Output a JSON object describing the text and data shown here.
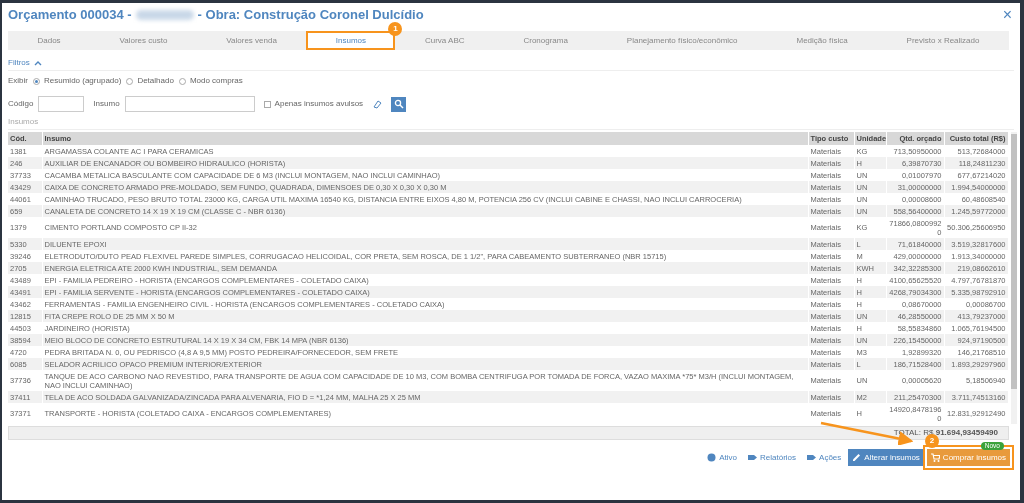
{
  "window": {
    "title_prefix": "Orçamento 000034 -",
    "title_suffix": "- Obra: Construção Coronel Dulcídio",
    "close": "×"
  },
  "tabs": [
    {
      "label": "Dados",
      "selected": false
    },
    {
      "label": "Valores custo",
      "selected": false
    },
    {
      "label": "Valores venda",
      "selected": false
    },
    {
      "label": "Insumos",
      "selected": true,
      "callout": "1"
    },
    {
      "label": "Curva ABC",
      "selected": false
    },
    {
      "label": "Cronograma",
      "selected": false
    },
    {
      "label": "Planejamento físico/econômico",
      "selected": false
    },
    {
      "label": "Medição física",
      "selected": false
    },
    {
      "label": "Previsto x Realizado",
      "selected": false
    }
  ],
  "filters": {
    "title": "Filtros",
    "expanded": true,
    "show_label": "Exibir",
    "radios": [
      {
        "label": "Resumido (agrupado)",
        "selected": true
      },
      {
        "label": "Detalhado",
        "selected": false
      },
      {
        "label": "Modo compras",
        "selected": false
      }
    ],
    "code_label": "Código",
    "item_label": "Insumo",
    "only_loose": {
      "label": "Apenas insumos avulsos",
      "checked": false
    }
  },
  "table": {
    "section": "Insumos",
    "columns": [
      "Cód.",
      "Insumo",
      "Tipo custo",
      "Unidade",
      "Qtd. orçado",
      "Custo total (R$)"
    ],
    "rows": [
      [
        "1381",
        "ARGAMASSA COLANTE AC I PARA CERAMICAS",
        "Materiais",
        "KG",
        "713,50950000",
        "513,72684000"
      ],
      [
        "246",
        "AUXILIAR DE ENCANADOR OU BOMBEIRO HIDRAULICO (HORISTA)",
        "Materiais",
        "H",
        "6,39870730",
        "118,24811230"
      ],
      [
        "37733",
        "CACAMBA METALICA BASCULANTE COM CAPACIDADE DE 6 M3 (INCLUI MONTAGEM, NAO INCLUI CAMINHAO)",
        "Materiais",
        "UN",
        "0,01007970",
        "677,67214020"
      ],
      [
        "43429",
        "CAIXA DE CONCRETO ARMADO PRE-MOLDADO, SEM FUNDO, QUADRADA, DIMENSOES DE 0,30 X 0,30 X 0,30 M",
        "Materiais",
        "UN",
        "31,00000000",
        "1.994,54000000"
      ],
      [
        "44061",
        "CAMINHAO TRUCADO, PESO BRUTO TOTAL 23000 KG, CARGA UTIL MAXIMA 16540 KG, DISTANCIA ENTRE EIXOS 4,80 M, POTENCIA 256 CV (INCLUI CABINE E CHASSI, NAO INCLUI CARROCERIA)",
        "Materiais",
        "UN",
        "0,00008600",
        "60,48608540"
      ],
      [
        "659",
        "CANALETA DE CONCRETO 14 X 19 X 19 CM (CLASSE C - NBR 6136)",
        "Materiais",
        "UN",
        "558,56400000",
        "1.245,59772000"
      ],
      [
        "1379",
        "CIMENTO PORTLAND COMPOSTO CP II-32",
        "Materiais",
        "KG",
        "71866,08009920",
        "50.306,25606950"
      ],
      [
        "5330",
        "DILUENTE EPOXI",
        "Materiais",
        "L",
        "71,61840000",
        "3.519,32817600"
      ],
      [
        "39246",
        "ELETRODUTO/DUTO PEAD FLEXIVEL PAREDE SIMPLES, CORRUGACAO HELICOIDAL, COR PRETA, SEM ROSCA, DE 1 1/2\", PARA CABEAMENTO SUBTERRANEO (NBR 15715)",
        "Materiais",
        "M",
        "429,00000000",
        "1.913,34000000"
      ],
      [
        "2705",
        "ENERGIA ELETRICA ATE 2000 KWH INDUSTRIAL, SEM DEMANDA",
        "Materiais",
        "KWH",
        "342,32285300",
        "219,08662610"
      ],
      [
        "43489",
        "EPI - FAMILIA PEDREIRO - HORISTA (ENCARGOS COMPLEMENTARES - COLETADO CAIXA)",
        "Materiais",
        "H",
        "4100,65625520",
        "4.797,76781870"
      ],
      [
        "43491",
        "EPI - FAMILIA SERVENTE - HORISTA (ENCARGOS COMPLEMENTARES - COLETADO CAIXA)",
        "Materiais",
        "H",
        "4268,79034300",
        "5.335,98792910"
      ],
      [
        "43462",
        "FERRAMENTAS - FAMILIA ENGENHEIRO CIVIL - HORISTA (ENCARGOS COMPLEMENTARES - COLETADO CAIXA)",
        "Materiais",
        "H",
        "0,08670000",
        "0,00086700"
      ],
      [
        "12815",
        "FITA CREPE ROLO DE 25 MM X 50 M",
        "Materiais",
        "UN",
        "46,28550000",
        "413,79237000"
      ],
      [
        "44503",
        "JARDINEIRO (HORISTA)",
        "Materiais",
        "H",
        "58,55834860",
        "1.065,76194500"
      ],
      [
        "38594",
        "MEIO BLOCO DE CONCRETO ESTRUTURAL 14 X 19 X 34 CM, FBK 14 MPA (NBR 6136)",
        "Materiais",
        "UN",
        "226,15450000",
        "924,97190500"
      ],
      [
        "4720",
        "PEDRA BRITADA N. 0, OU PEDRISCO (4,8 A 9,5 MM) POSTO PEDREIRA/FORNECEDOR, SEM FRETE",
        "Materiais",
        "M3",
        "1,92899320",
        "146,21768510"
      ],
      [
        "6085",
        "SELADOR ACRILICO OPACO PREMIUM INTERIOR/EXTERIOR",
        "Materiais",
        "L",
        "186,71528400",
        "1.893,29297960"
      ],
      [
        "37736",
        "TANQUE DE ACO CARBONO NAO REVESTIDO, PARA TRANSPORTE DE AGUA COM CAPACIDADE DE 10 M3, COM BOMBA CENTRIFUGA POR TOMADA DE FORCA, VAZAO MAXIMA *75* M3/H (INCLUI MONTAGEM, NAO INCLUI CAMINHAO)",
        "Materiais",
        "UN",
        "0,00005620",
        "5,18506940"
      ],
      [
        "37411",
        "TELA DE ACO SOLDADA GALVANIZADA/ZINCADA PARA ALVENARIA, FIO D = *1,24 MM, MALHA 25 X 25 MM",
        "Materiais",
        "M2",
        "211,25470300",
        "3.711,74513160"
      ],
      [
        "37371",
        "TRANSPORTE - HORISTA (COLETADO CAIXA - ENCARGOS COMPLEMENTARES)",
        "Materiais",
        "H",
        "14920,84781960",
        "12.831,92912490"
      ]
    ],
    "total": "TOTAL: R$ **91.694,93459490**"
  },
  "buttons": [
    {
      "kind": "status",
      "label": "Ativo"
    },
    {
      "kind": "tag",
      "label": "Relatórios"
    },
    {
      "kind": "tag",
      "label": "Ações"
    },
    {
      "kind": "edit",
      "label": "Alterar insumos"
    },
    {
      "kind": "cart",
      "label": "Comprar insumos",
      "badge": "Novo",
      "callout": "2"
    }
  ]
}
